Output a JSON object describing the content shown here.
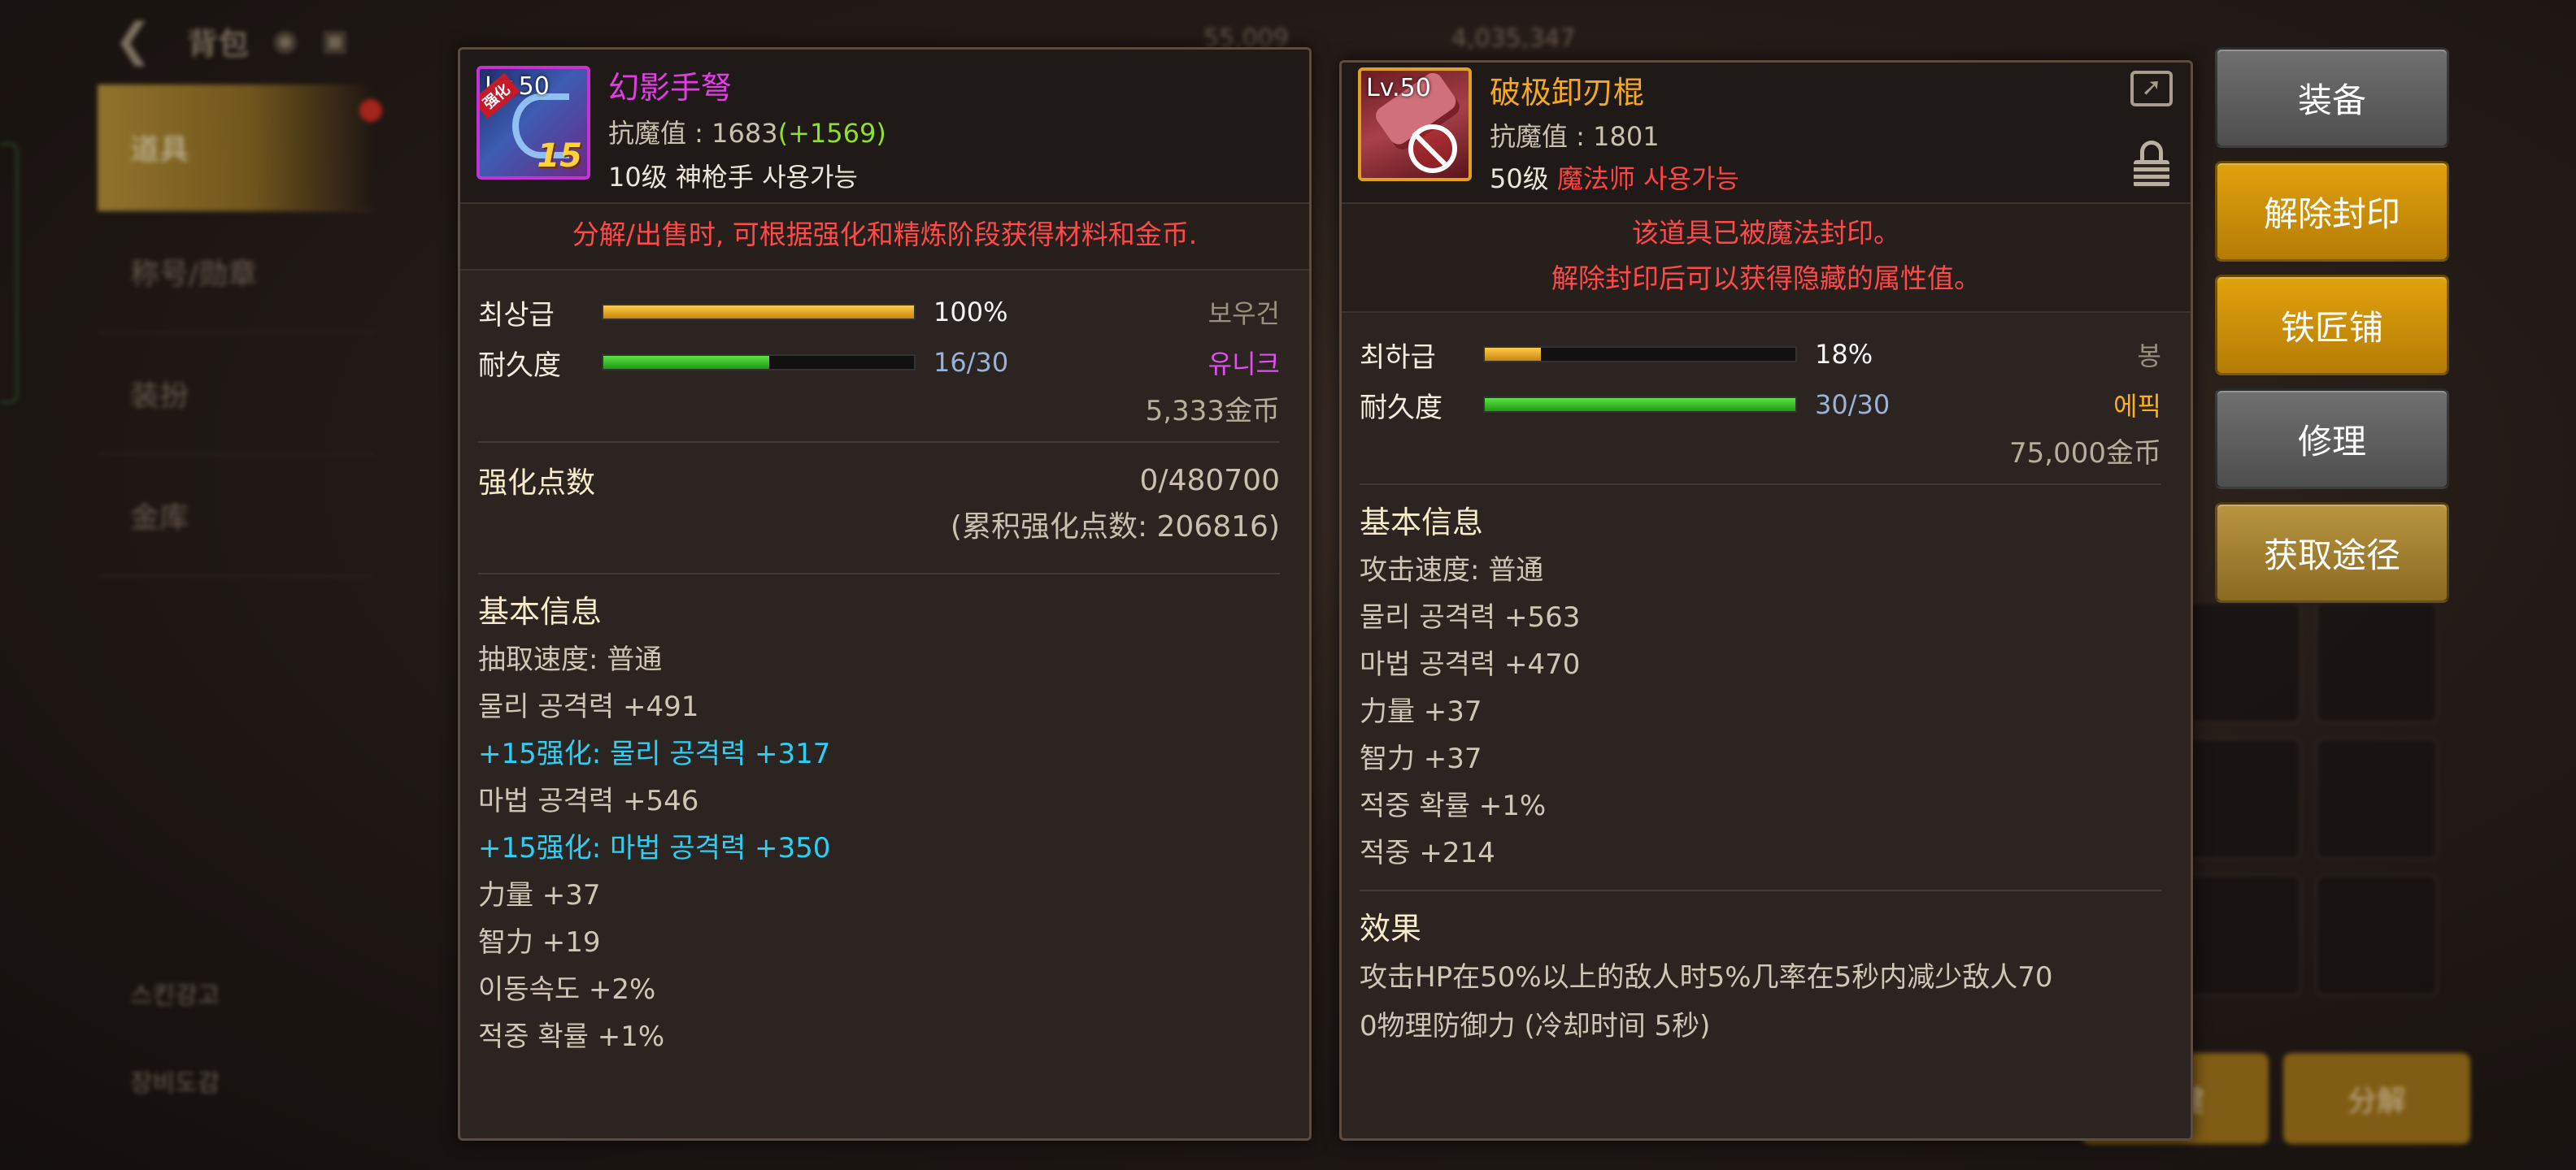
{
  "background": {
    "top_title": "背包",
    "nav_items": [
      "道具",
      "称号/勋章",
      "装扮",
      "金库"
    ],
    "bottom_links": [
      "스킨강고",
      "장비도감"
    ],
    "top_right_texts": [
      "55,009",
      "4,035,347"
    ],
    "bottom_buttons": [
      "一键",
      "分解"
    ]
  },
  "left_item": {
    "level_label": "Lv.50",
    "badge": "强化",
    "enhance_overlay": "15",
    "name": "幻影手弩",
    "resist_label": "抗魔值 : 1683",
    "resist_bonus": "(+1569)",
    "req_level": "10级",
    "req_class": "神枪手 사용가능",
    "notice": "分解/出售时, 可根据强化和精炼阶段获得材料和金币.",
    "grade_label": "최상급",
    "grade_percent": 100,
    "grade_text": "100%",
    "durability_label": "耐久度",
    "durability_current": 16,
    "durability_max": 30,
    "durability_text": "16/30",
    "type": "보우건",
    "rarity": "유니크",
    "price": "5,333金币",
    "enhance_points_label": "强化点数",
    "enhance_points_value": "0/480700",
    "enhance_points_total": "(累积强化点数: 206816)",
    "basic_info_title": "基本信息",
    "stats": [
      {
        "text": "抽取速度:  普通",
        "style": "normal"
      },
      {
        "text": "물리 공격력 +491",
        "style": "normal"
      },
      {
        "text": "+15强化:  물리 공격력 +317",
        "style": "cyan"
      },
      {
        "text": "마법 공격력 +546",
        "style": "normal"
      },
      {
        "text": "+15强化:  마법 공격력 +350",
        "style": "cyan"
      },
      {
        "text": "力量 +37",
        "style": "normal"
      },
      {
        "text": "智力 +19",
        "style": "normal"
      },
      {
        "text": "이동속도 +2%",
        "style": "normal"
      },
      {
        "text": "적중 확률 +1%",
        "style": "normal"
      }
    ]
  },
  "right_item": {
    "level_label": "Lv.50",
    "name": "破极卸刃棍",
    "resist_label": "抗魔值 : 1801",
    "req_level": "50级",
    "req_class": "魔法师 사용가능",
    "notice_line1": "该道具已被魔法封印。",
    "notice_line2": "解除封印后可以获得隐藏的属性值。",
    "grade_label": "최하급",
    "grade_percent": 18,
    "grade_text": "18%",
    "durability_label": "耐久度",
    "durability_current": 30,
    "durability_max": 30,
    "durability_text": "30/30",
    "type": "봉",
    "rarity": "에픽",
    "price": "75,000金币",
    "basic_info_title": "基本信息",
    "stats": [
      "攻击速度:  普通",
      "물리 공격력 +563",
      "마법 공격력 +470",
      "力量 +37",
      "智力 +37",
      "적중 확률 +1%",
      "적중 +214"
    ],
    "effect_title": "效果",
    "effect_line1": "攻击HP在50%以上的敌人时5%几率在5秒内减少敌人70",
    "effect_line2": "0物理防御力 (冷却时间 5秒)"
  },
  "actions": {
    "equip": "装备",
    "unseal": "解除封印",
    "blacksmith": "铁匠铺",
    "repair": "修理",
    "obtain": "获取途径"
  },
  "colors": {
    "left_name": "#e33ce8",
    "right_name": "#f4a822",
    "notice_red": "#ff4a4a",
    "enhance_cyan": "#2cd0f5",
    "resist_bonus_green": "#8fe02a",
    "unique": "#e24ef0",
    "epic": "#ffae1a",
    "btn_gold": "#c98f0a",
    "btn_grey": "#5f5f5f",
    "btn_tan": "#a7822f"
  }
}
